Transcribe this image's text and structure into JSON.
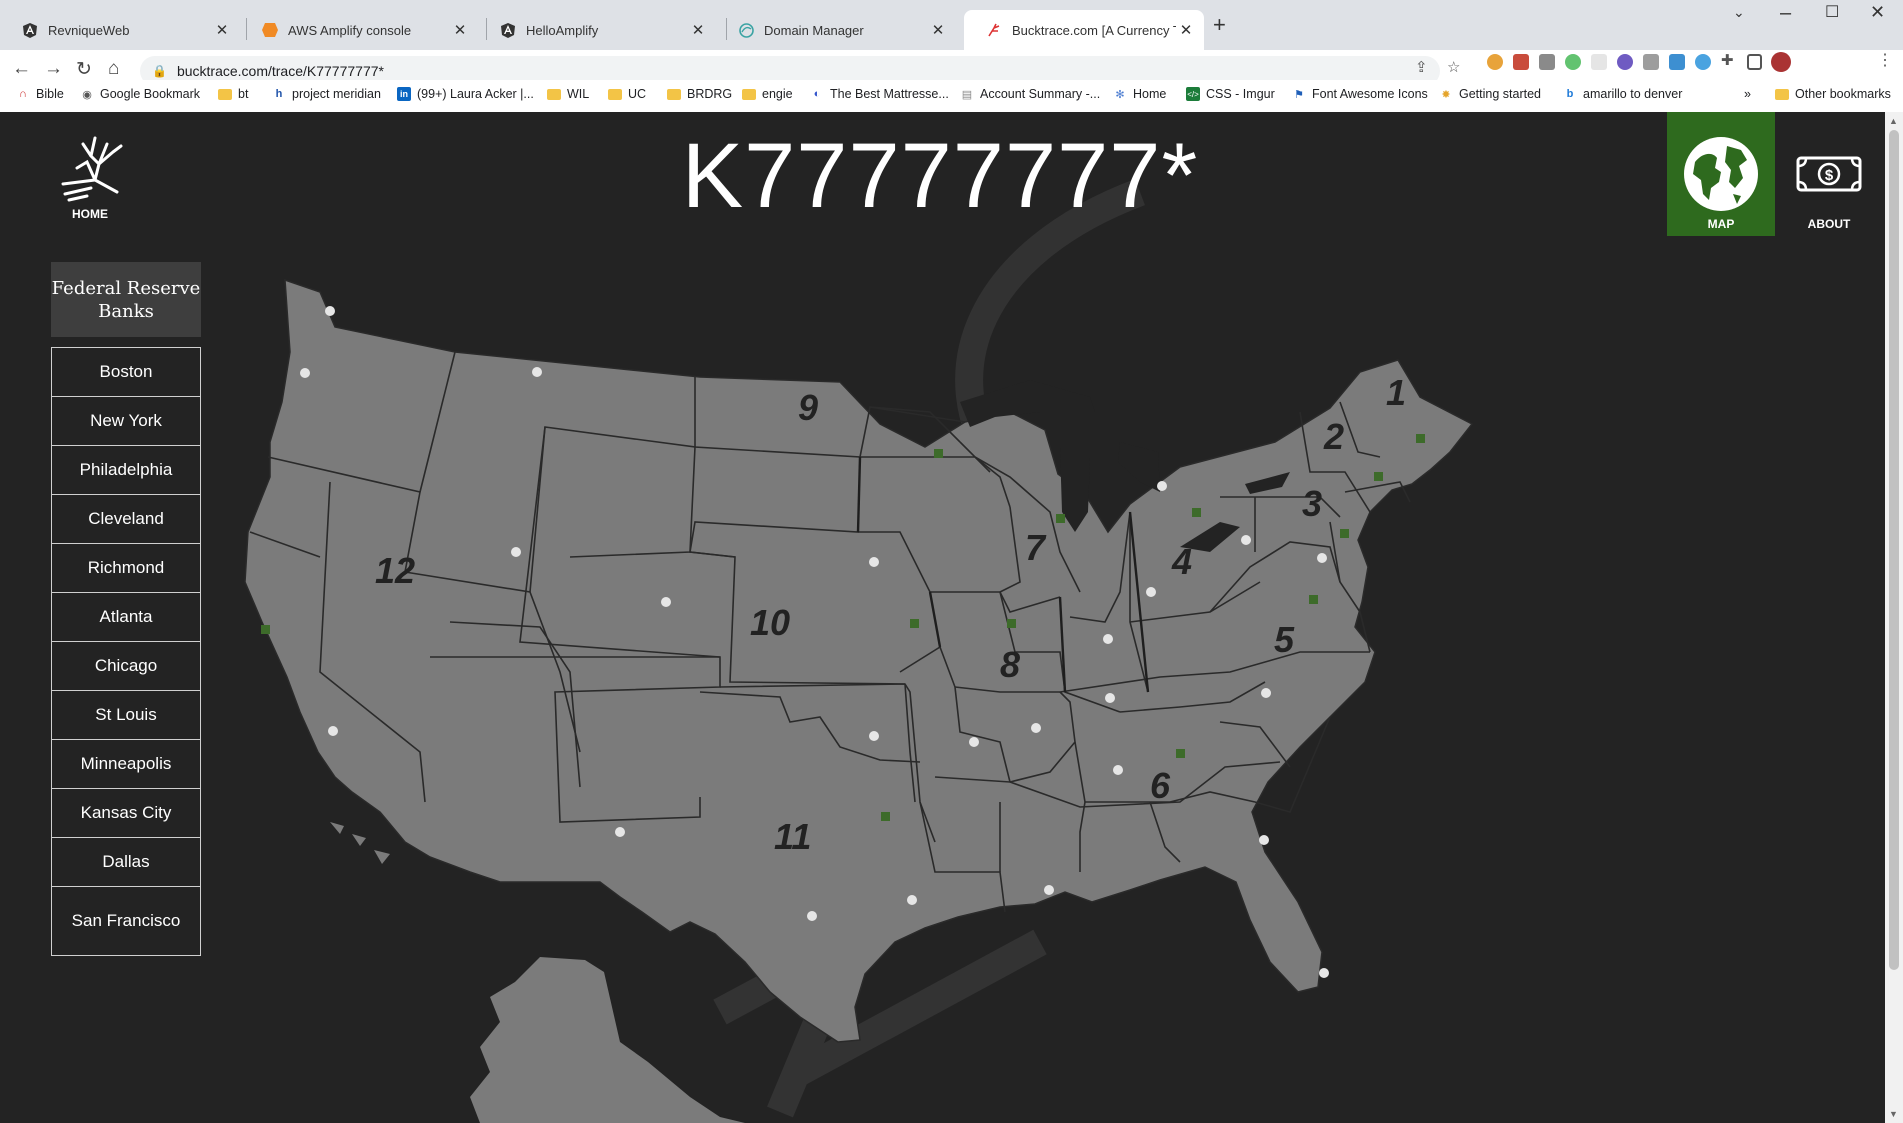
{
  "browser": {
    "tabs": [
      {
        "title": "RevniqueWeb",
        "icon": "angular-icon"
      },
      {
        "title": "AWS Amplify console",
        "icon": "aws-amplify-icon"
      },
      {
        "title": "HelloAmplify",
        "icon": "angular-icon"
      },
      {
        "title": "Domain Manager",
        "icon": "globe-icon"
      },
      {
        "title": "Bucktrace.com [A Currency Track",
        "icon": "bucktrace-icon"
      }
    ],
    "url": "bucktrace.com/trace/K77777777*",
    "bookmarks": [
      {
        "label": "Bible",
        "icon": "magnet-icon"
      },
      {
        "label": "Google Bookmark",
        "icon": "globe-icon"
      },
      {
        "label": "bt",
        "icon": "folder-icon"
      },
      {
        "label": "project meridian",
        "icon": "h-icon"
      },
      {
        "label": "(99+) Laura Acker |...",
        "icon": "linkedin-icon"
      },
      {
        "label": "WIL",
        "icon": "folder-icon"
      },
      {
        "label": "UC",
        "icon": "folder-icon"
      },
      {
        "label": "BRDRG",
        "icon": "folder-icon"
      },
      {
        "label": "engie",
        "icon": "folder-icon"
      },
      {
        "label": "The Best Mattresse...",
        "icon": "site-icon"
      },
      {
        "label": "Account Summary -...",
        "icon": "page-icon"
      },
      {
        "label": "Home",
        "icon": "snowflake-icon"
      },
      {
        "label": "CSS - Imgur",
        "icon": "code-icon"
      },
      {
        "label": "Font Awesome Icons",
        "icon": "flag-icon"
      },
      {
        "label": "Getting started",
        "icon": "pinwheel-icon"
      },
      {
        "label": "amarillo to denver",
        "icon": "bing-icon"
      }
    ],
    "other_bookmarks": "Other bookmarks",
    "more_bookmarks": "»"
  },
  "page": {
    "home_label": "HOME",
    "title": "K77777777*",
    "nav": {
      "map_label": "MAP",
      "about_label": "ABOUT"
    },
    "frb_heading": "Federal Reserve Banks",
    "frb_banks": [
      "Boston",
      "New York",
      "Philadelphia",
      "Cleveland",
      "Richmond",
      "Atlanta",
      "Chicago",
      "St Louis",
      "Minneapolis",
      "Kansas City",
      "Dallas",
      "San Francisco"
    ],
    "district_numbers": [
      "1",
      "2",
      "3",
      "4",
      "5",
      "6",
      "7",
      "8",
      "9",
      "10",
      "11",
      "12"
    ],
    "colors": {
      "background": "#232323",
      "map_fill": "#7b7b7b",
      "map_active": "#2e6a1e",
      "fed_bank_marker": "#3d6b2a",
      "branch_marker": "#e6e6e6"
    }
  }
}
